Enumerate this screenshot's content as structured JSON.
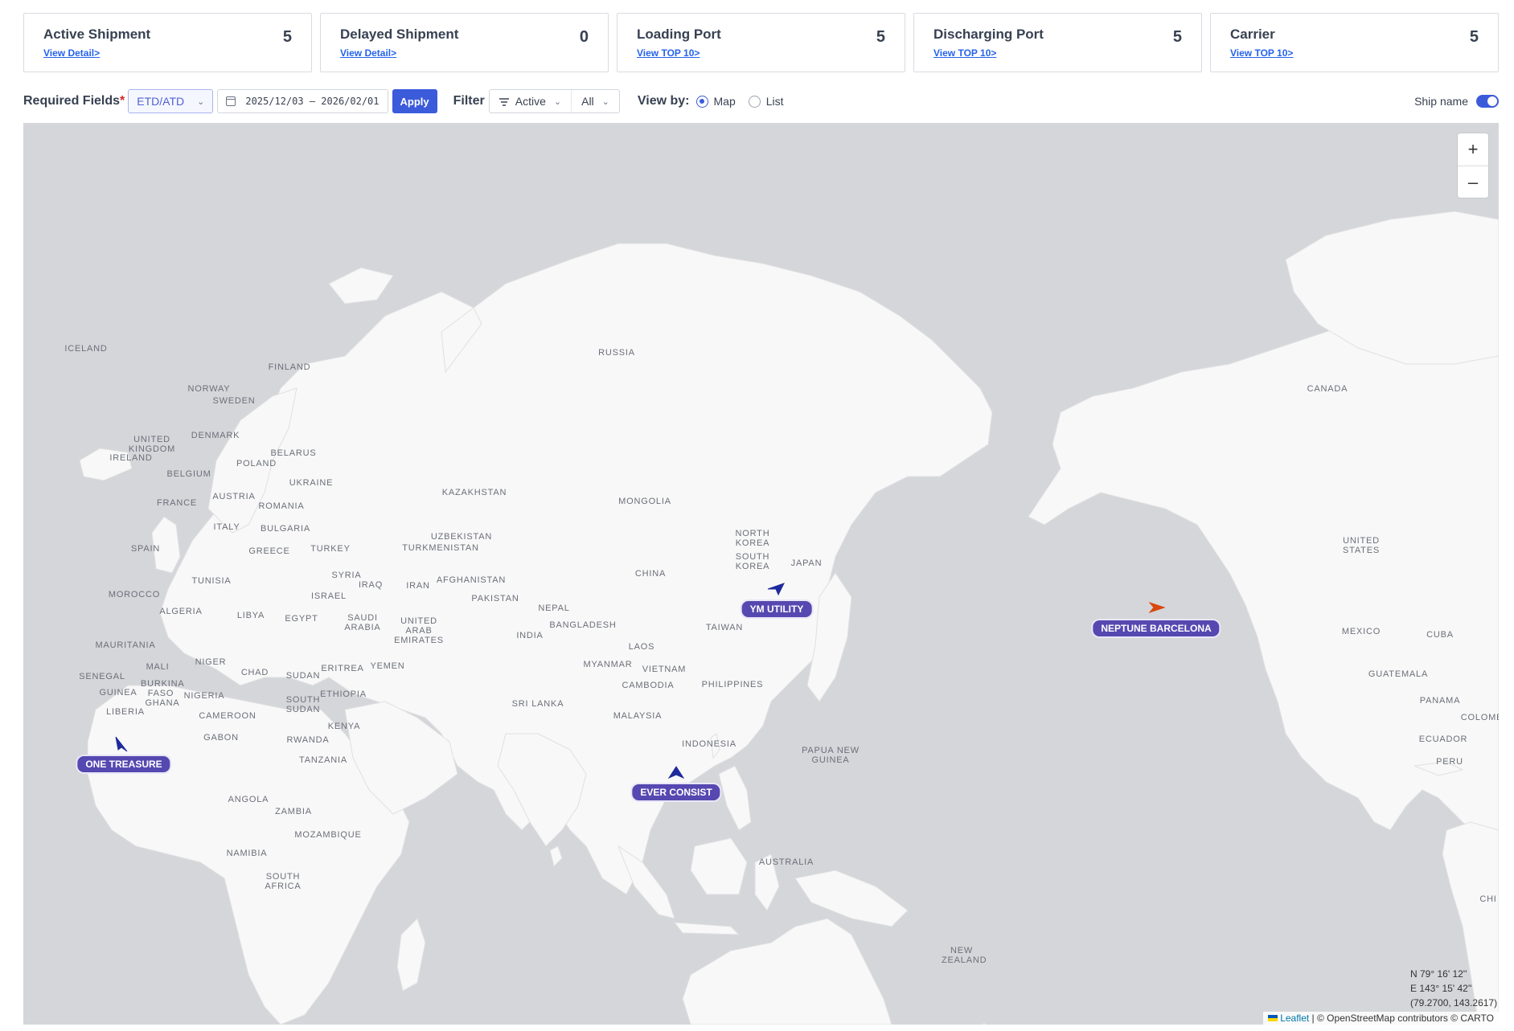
{
  "cards": [
    {
      "title": "Active Shipment",
      "link": "View Detail>",
      "count": "5"
    },
    {
      "title": "Delayed Shipment",
      "link": "View Detail>",
      "count": "0"
    },
    {
      "title": "Loading Port",
      "link": "View TOP 10>",
      "count": "5"
    },
    {
      "title": "Discharging Port",
      "link": "View TOP 10>",
      "count": "5"
    },
    {
      "title": "Carrier",
      "link": "View TOP 10>",
      "count": "5"
    }
  ],
  "toolbar": {
    "required_label": "Required Fields",
    "required_star": "*",
    "date_type": "ETD/ATD",
    "date_range": "2025/12/03 – 2026/02/01",
    "apply": "Apply",
    "filter_label": "Filter",
    "status_filter": "Active",
    "scope_filter": "All",
    "viewby_label": "View by:",
    "view_map": "Map",
    "view_list": "List",
    "selected_view": "Map",
    "ship_name_label": "Ship name",
    "ship_name_enabled": true
  },
  "map": {
    "zoom_in": "+",
    "zoom_out": "–",
    "places": [
      {
        "name": "RUSSIA"
      },
      {
        "name": "CANADA"
      },
      {
        "name": "ICELAND"
      },
      {
        "name": "FINLAND"
      },
      {
        "name": "NORWAY"
      },
      {
        "name": "SWEDEN"
      },
      {
        "name": "UNITED KINGDOM"
      },
      {
        "name": "IRELAND"
      },
      {
        "name": "DENMARK"
      },
      {
        "name": "BELARUS"
      },
      {
        "name": "POLAND"
      },
      {
        "name": "BELGIUM"
      },
      {
        "name": "UKRAINE"
      },
      {
        "name": "AUSTRIA"
      },
      {
        "name": "FRANCE"
      },
      {
        "name": "ROMANIA"
      },
      {
        "name": "ITALY"
      },
      {
        "name": "BULGARIA"
      },
      {
        "name": "KAZAKHSTAN"
      },
      {
        "name": "MONGOLIA"
      },
      {
        "name": "SPAIN"
      },
      {
        "name": "GREECE"
      },
      {
        "name": "TURKEY"
      },
      {
        "name": "UZBEKISTAN"
      },
      {
        "name": "TURKMENISTAN"
      },
      {
        "name": "NORTH KOREA"
      },
      {
        "name": "SOUTH KOREA"
      },
      {
        "name": "JAPAN"
      },
      {
        "name": "UNITED STATES"
      },
      {
        "name": "TUNISIA"
      },
      {
        "name": "SYRIA"
      },
      {
        "name": "IRAQ"
      },
      {
        "name": "IRAN"
      },
      {
        "name": "AFGHANISTAN"
      },
      {
        "name": "CHINA"
      },
      {
        "name": "MOROCCO"
      },
      {
        "name": "ISRAEL"
      },
      {
        "name": "PAKISTAN"
      },
      {
        "name": "ALGERIA"
      },
      {
        "name": "LIBYA"
      },
      {
        "name": "EGYPT"
      },
      {
        "name": "SAUDI ARABIA"
      },
      {
        "name": "UNITED ARAB EMIRATES"
      },
      {
        "name": "NEPAL"
      },
      {
        "name": "INDIA"
      },
      {
        "name": "BANGLADESH"
      },
      {
        "name": "TAIWAN"
      },
      {
        "name": "MEXICO"
      },
      {
        "name": "CUBA"
      },
      {
        "name": "MAURITANIA"
      },
      {
        "name": "LAOS"
      },
      {
        "name": "NIGER"
      },
      {
        "name": "MALI"
      },
      {
        "name": "CHAD"
      },
      {
        "name": "SUDAN"
      },
      {
        "name": "ERITREA"
      },
      {
        "name": "YEMEN"
      },
      {
        "name": "MYANMAR"
      },
      {
        "name": "VIETNAM"
      },
      {
        "name": "SENEGAL"
      },
      {
        "name": "BURKINA FASO"
      },
      {
        "name": "GUINEA"
      },
      {
        "name": "NIGERIA"
      },
      {
        "name": "CAMBODIA"
      },
      {
        "name": "PHILIPPINES"
      },
      {
        "name": "GUATEMALA"
      },
      {
        "name": "ETHIOPIA"
      },
      {
        "name": "SOUTH SUDAN"
      },
      {
        "name": "GHANA"
      },
      {
        "name": "PANAMA"
      },
      {
        "name": "SRI LANKA"
      },
      {
        "name": "LIBERIA"
      },
      {
        "name": "CAMEROON"
      },
      {
        "name": "COLOMB"
      },
      {
        "name": "MALAYSIA"
      },
      {
        "name": "KENYA"
      },
      {
        "name": "GABON"
      },
      {
        "name": "RWANDA"
      },
      {
        "name": "ECUADOR"
      },
      {
        "name": "INDONESIA"
      },
      {
        "name": "PAPUA NEW GUINEA"
      },
      {
        "name": "PERU"
      },
      {
        "name": "TANZANIA"
      },
      {
        "name": "ANGOLA"
      },
      {
        "name": "ZAMBIA"
      },
      {
        "name": "MOZAMBIQUE"
      },
      {
        "name": "NAMIBIA"
      },
      {
        "name": "AUSTRALIA"
      },
      {
        "name": "SOUTH AFRICA"
      },
      {
        "name": "CHI"
      },
      {
        "name": "NEW ZEALAND"
      }
    ],
    "ships": [
      {
        "name": "YM UTILITY",
        "color": "#1e2a9c"
      },
      {
        "name": "NEPTUNE BARCELONA",
        "color": "#d9480f"
      },
      {
        "name": "ONE TREASURE",
        "color": "#1e2a9c"
      },
      {
        "name": "EVER CONSIST",
        "color": "#1e2a9c"
      }
    ],
    "coords": {
      "lat": "N 79° 16' 12''",
      "lon": "E 143° 15' 42''",
      "decimal": "(79.2700, 143.2617)"
    },
    "attribution": {
      "leaflet": "Leaflet",
      "rest": " | © OpenStreetMap contributors © CARTO"
    }
  },
  "colors": {
    "accent": "#3b5bdb",
    "ship_label_bg": "#5548b0",
    "land": "#f8f8f8",
    "water": "#d4d6da"
  }
}
